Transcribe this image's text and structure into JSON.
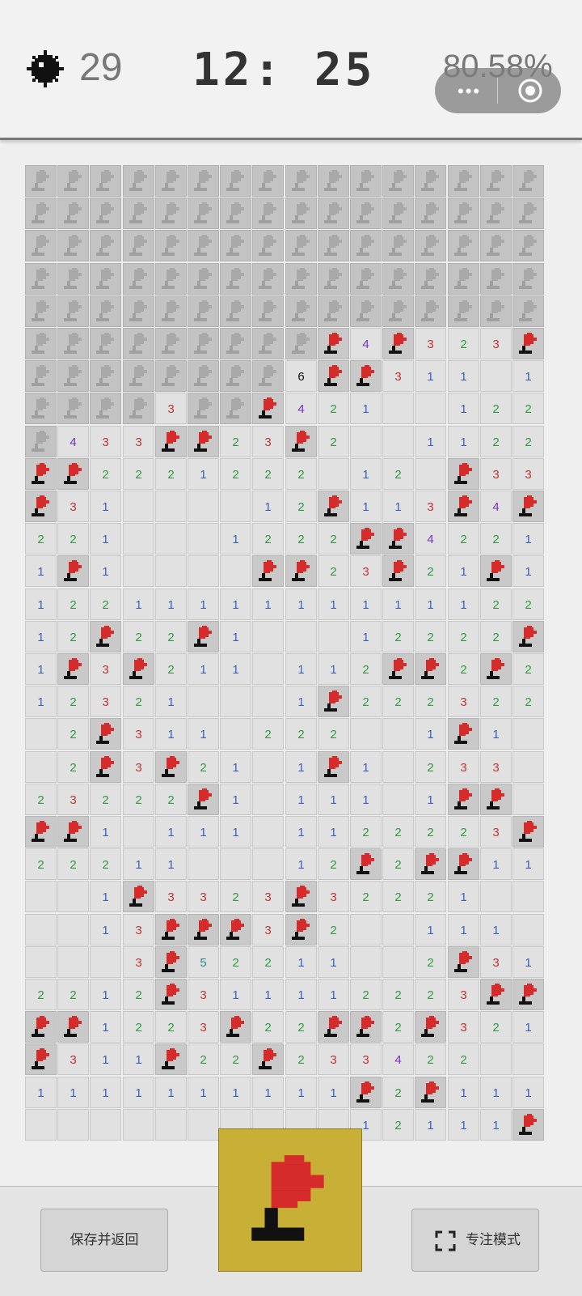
{
  "header": {
    "mine_icon": "mine-icon",
    "mines_remaining": "29",
    "timer": "12: 25",
    "progress": "80.58%",
    "capsule": {
      "more_icon": "more-icon",
      "close_icon": "target-icon"
    }
  },
  "board": {
    "cols": 16,
    "rows": 30,
    "legend": "H = unrevealed cell, F = flag, 0 = empty revealed cell, 1-8 = adjacent mine count",
    "cells": [
      "HHHHHHHHHHHHHHHH",
      "HHHHHHHHHHHHHHHH",
      "HHHHHHHHHHHHHHHH",
      "HHHHHHHHHHHHHHHH",
      "HHHHHHHHHHHHHHHH",
      "HHHHHHHHHF4F323F",
      "HHHHHHHH6FF31101",
      "HHHH3HHF42100122",
      "H433FF23F2001122FF",
      "FF22212220120F332",
      "F31000012F113F4F10",
      "2210001222FF4221",
      "1F10000FF23F21F1",
      "1221111111111122",
      "12F22F10001222 2F",
      "1F3F211011 2FF2F2",
      "12321000 1F222322",
      "0 2F3110 222001F1",
      "02F3F21 01F10233",
      "2322 2F101110 1FF",
      "FF101110 1122223F",
      "22211000 12F2FF111",
      "001F3323F3222100",
      "0013FFF3F2001110",
      "0003F52211002F31",
      "2212F311112223FF1",
      "FF1223F22FF2F321",
      "F311F22F2334220 0",
      "11 11111111F2F111",
      "000000000012111F"
    ],
    "number_colors": {
      "1": "#3b5fbf",
      "2": "#2f9a3e",
      "3": "#c03333",
      "4": "#7b2fc0",
      "5": "#2b8c8c",
      "6": "#111111"
    },
    "flag_color": "#d62b2b"
  },
  "controls": {
    "save_label": "保存并返回",
    "focus_label": "专注模式",
    "focus_icon": "expand-frame-icon",
    "mode_icon": "flag-mode-icon",
    "mode_color": "#c7b035"
  }
}
